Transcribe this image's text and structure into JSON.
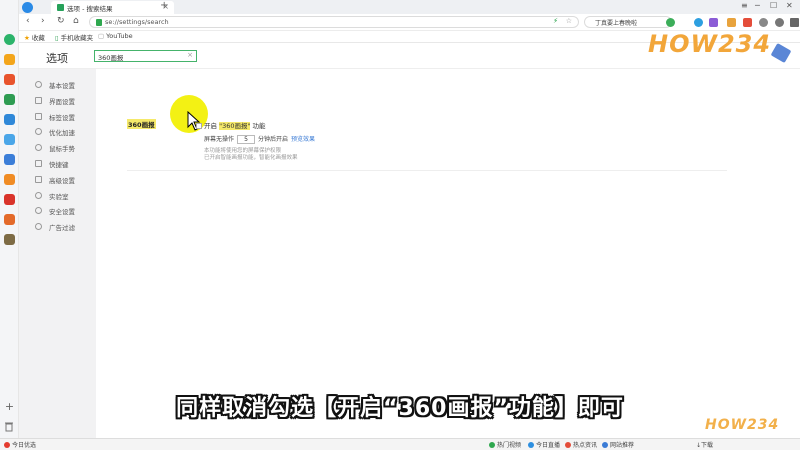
{
  "browser": {
    "tab_title": "选项 - 搜索结果",
    "tab_close": "×",
    "new_tab": "+",
    "address_url": "se://settings/search",
    "search_query": "丁真要上春晚啦",
    "window_controls": [
      "≡",
      "─",
      "☐",
      "✕"
    ]
  },
  "bookmarks": {
    "favorites": "收藏",
    "mobile": "手机收藏夹",
    "youtube": "YouTube"
  },
  "settings": {
    "title": "选项",
    "search_value": "360画报",
    "search_clear": "×",
    "sidebar": [
      {
        "label": "基本设置",
        "icon": "home-icon"
      },
      {
        "label": "界面设置",
        "icon": "layout-icon"
      },
      {
        "label": "标签设置",
        "icon": "tab-icon"
      },
      {
        "label": "优化加速",
        "icon": "speed-icon"
      },
      {
        "label": "鼠标手势",
        "icon": "mouse-icon"
      },
      {
        "label": "快捷键",
        "icon": "keyboard-icon"
      },
      {
        "label": "高级设置",
        "icon": "advanced-icon"
      },
      {
        "label": "实验室",
        "icon": "lab-icon"
      },
      {
        "label": "安全设置",
        "icon": "shield-icon"
      },
      {
        "label": "广告过滤",
        "icon": "block-icon"
      }
    ],
    "section_label": "360画报",
    "option_prefix": "开启",
    "option_highlight": "\"360画报\"",
    "option_suffix": "功能",
    "idle_prefix": "屏幕无操作",
    "idle_minutes": "5",
    "idle_suffix": "分钟后开启",
    "preview_link": "预览效果",
    "note_1": "本功能将使用您的屏幕保护权限",
    "note_2": "已开启智能画报功能，智能化画报效果"
  },
  "caption": "同样取消勾选【开启“360画报”功能】即可",
  "watermark": "HOW234",
  "statusbar": {
    "left": "今日优选",
    "items": [
      "热门视频",
      "今日直播",
      "热点资讯",
      "网站推荐"
    ],
    "download": "下载"
  },
  "colors": {
    "highlight_yellow": "#f2f000",
    "accent_green": "#45b36b",
    "link_blue": "#3a7bd5"
  }
}
